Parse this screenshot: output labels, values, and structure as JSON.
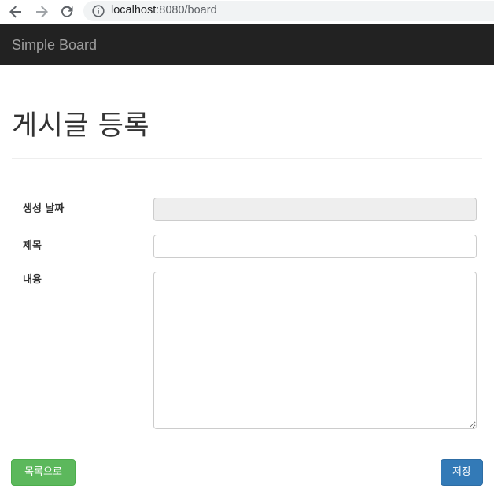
{
  "browser": {
    "url_host": "localhost",
    "url_rest": ":8080/board"
  },
  "navbar": {
    "brand": "Simple Board"
  },
  "page": {
    "title": "게시글 등록"
  },
  "form": {
    "date": {
      "label": "생성 날짜",
      "value": ""
    },
    "title": {
      "label": "제목",
      "value": ""
    },
    "content": {
      "label": "내용",
      "value": ""
    }
  },
  "buttons": {
    "list_label": "목록으로",
    "save_label": "저장"
  },
  "colors": {
    "navbar_bg": "#222222",
    "success": "#5cb85c",
    "primary": "#337ab7"
  },
  "icons": [
    "back-arrow-icon",
    "forward-arrow-icon",
    "reload-icon",
    "info-icon"
  ]
}
